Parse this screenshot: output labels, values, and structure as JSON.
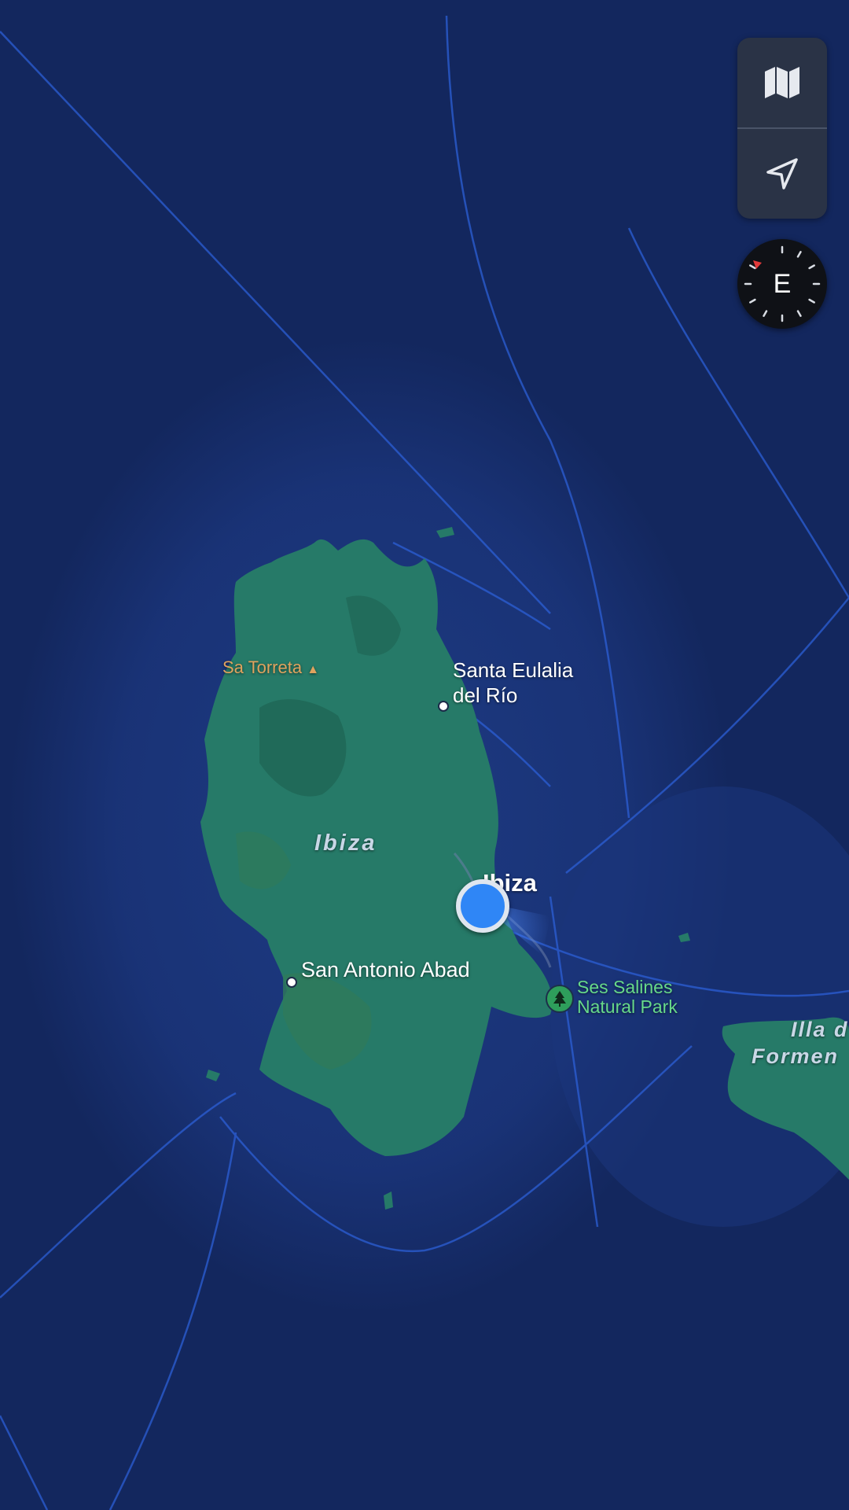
{
  "map": {
    "labels": {
      "sa_torreta": "Sa Torreta",
      "santa_eulalia_line1": "Santa Eulalia",
      "santa_eulalia_line2": "del Río",
      "ibiza_region": "Ibiza",
      "ibiza_city": "Ibiza",
      "san_antonio": "San Antonio Abad",
      "ses_salines_line1": "Ses Salines",
      "ses_salines_line2": "Natural Park",
      "formentera_line1": "Illa d",
      "formentera_line2": "Formen"
    },
    "colors": {
      "sea_deep": "#13275e",
      "sea_shallow": "#1d3a82",
      "land": "#267a68",
      "land_dark": "#1f6655",
      "route": "#2c5fd6",
      "user_location": "#2f86f6",
      "park_label": "#67d98a",
      "peak_label": "#e0a35e"
    },
    "icons": {
      "peak": "peak-triangle-icon",
      "park": "tree-icon"
    }
  },
  "controls": {
    "map_mode_icon": "map-icon",
    "locate_icon": "location-arrow-icon",
    "compass_heading": "E",
    "compass_icon": "compass-icon"
  }
}
